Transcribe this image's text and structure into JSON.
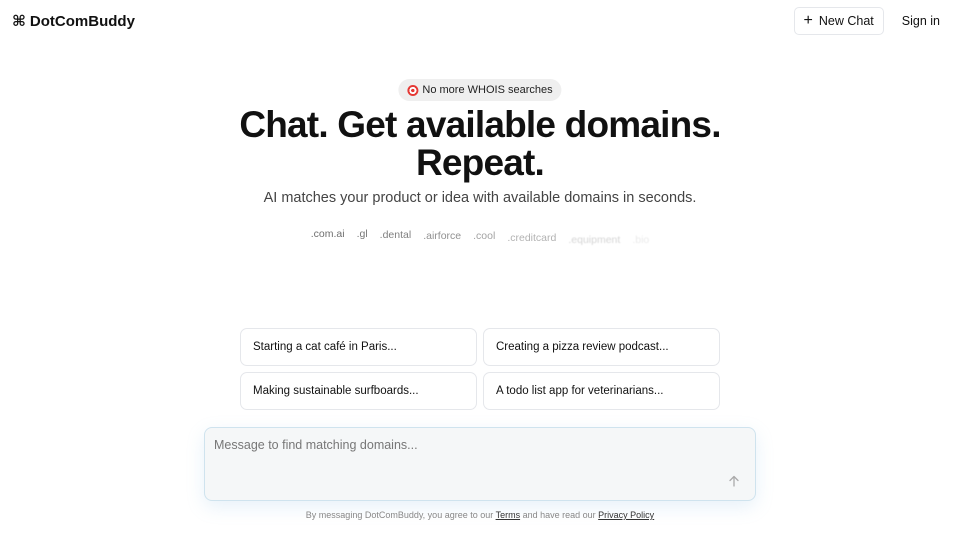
{
  "header": {
    "brand_icon": "⌘",
    "brand_name": "DotComBuddy",
    "new_chat_label": "New Chat",
    "sign_in_label": "Sign in"
  },
  "hero": {
    "badge_text": "No more WHOIS searches",
    "badge_icon": "target-icon",
    "title_line1": "Chat. Get available domains.",
    "title_line2": "Repeat.",
    "subtitle": "AI matches your product or idea with available domains in seconds.",
    "tlds": [
      ".com.ai",
      ".gl",
      ".dental",
      ".airforce",
      ".cool",
      ".creditcard",
      ".equipment",
      ".bio"
    ]
  },
  "suggestions": [
    "Starting a cat café in Paris...",
    "Creating a pizza review podcast...",
    "Making sustainable surfboards...",
    "A todo list app for veterinarians..."
  ],
  "chat": {
    "placeholder": "Message to find matching domains...",
    "value": "",
    "send_icon": "arrow-up-icon"
  },
  "legal": {
    "prefix": "By messaging DotComBuddy, you agree to our",
    "terms_label": "Terms",
    "middle": "and have read our",
    "privacy_label": "Privacy Policy"
  },
  "colors": {
    "text": "#111111",
    "muted": "#444444",
    "border": "#e5e7eb",
    "badge_bg": "#efefef",
    "input_bg": "#f5f7f8",
    "input_border": "#cfe3ee"
  }
}
